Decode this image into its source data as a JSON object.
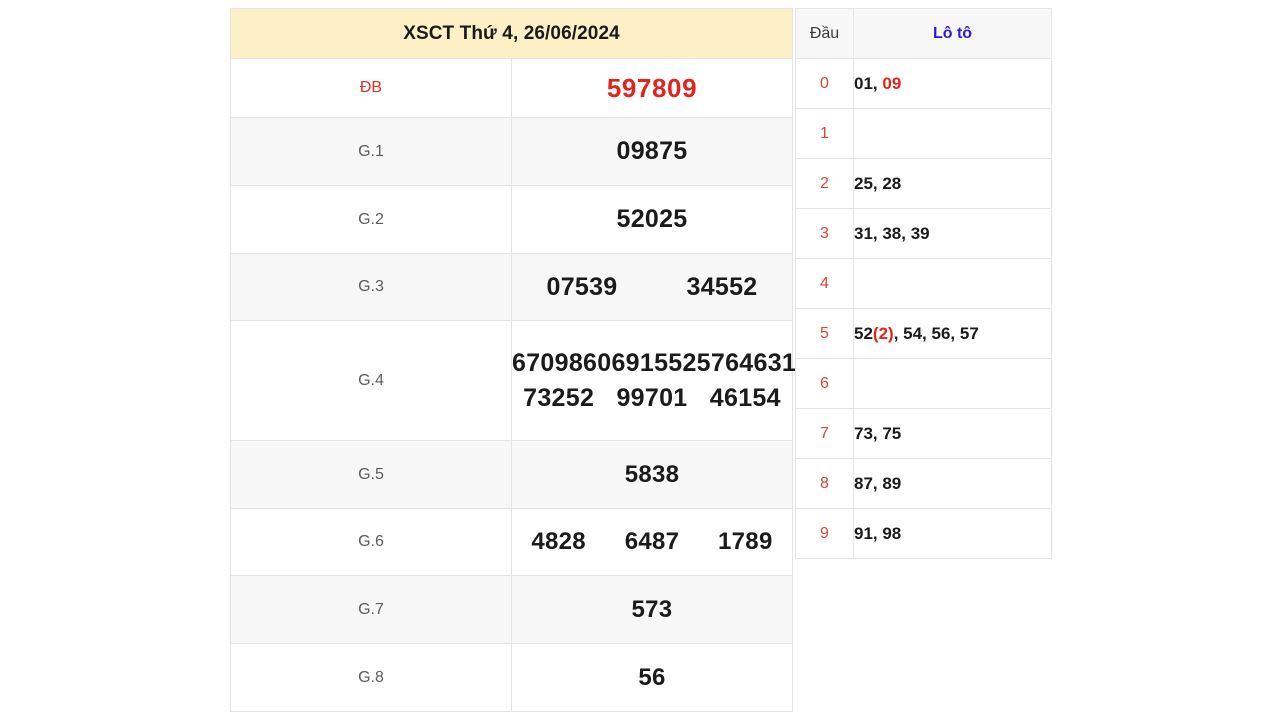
{
  "header": {
    "title": "XSCT Thứ 4, 26/06/2024"
  },
  "prize_table": {
    "rows": [
      {
        "label": "ĐB",
        "numbers": [
          [
            "597809"
          ]
        ]
      },
      {
        "label": "G.1",
        "numbers": [
          [
            "09875"
          ]
        ]
      },
      {
        "label": "G.2",
        "numbers": [
          [
            "52025"
          ]
        ]
      },
      {
        "label": "G.3",
        "numbers": [
          [
            "07539",
            "34552"
          ]
        ]
      },
      {
        "label": "G.4",
        "numbers": [
          [
            "67098",
            "60691",
            "55257",
            "64631"
          ],
          [
            "73252",
            "99701",
            "46154"
          ]
        ]
      },
      {
        "label": "G.5",
        "numbers": [
          [
            "5838"
          ]
        ]
      },
      {
        "label": "G.6",
        "numbers": [
          [
            "4828",
            "6487",
            "1789"
          ]
        ]
      },
      {
        "label": "G.7",
        "numbers": [
          [
            "573"
          ]
        ]
      },
      {
        "label": "G.8",
        "numbers": [
          [
            "56"
          ]
        ]
      }
    ]
  },
  "loto_table": {
    "header": {
      "dau": "Đầu",
      "loto": "Lô tô"
    },
    "rows": [
      {
        "dau": "0",
        "parts": [
          {
            "t": "01, ",
            "hl": false
          },
          {
            "t": "09",
            "hl": true
          }
        ]
      },
      {
        "dau": "1",
        "parts": []
      },
      {
        "dau": "2",
        "parts": [
          {
            "t": "25, 28",
            "hl": false
          }
        ]
      },
      {
        "dau": "3",
        "parts": [
          {
            "t": "31, 38, 39",
            "hl": false
          }
        ]
      },
      {
        "dau": "4",
        "parts": []
      },
      {
        "dau": "5",
        "parts": [
          {
            "t": "52",
            "hl": false
          },
          {
            "t": "(2)",
            "hl": true
          },
          {
            "t": ", 54, 56, 57",
            "hl": false
          }
        ]
      },
      {
        "dau": "6",
        "parts": []
      },
      {
        "dau": "7",
        "parts": [
          {
            "t": "73, 75",
            "hl": false
          }
        ]
      },
      {
        "dau": "8",
        "parts": [
          {
            "t": "87, 89",
            "hl": false
          }
        ]
      },
      {
        "dau": "9",
        "parts": [
          {
            "t": "91, 98",
            "hl": false
          }
        ]
      }
    ]
  },
  "colors": {
    "header_bg": "#fdefc6",
    "special_red": "#e0261c",
    "label_red": "#e03127",
    "dau_red": "#d9472f",
    "loto_blue": "#2a1ae0"
  }
}
